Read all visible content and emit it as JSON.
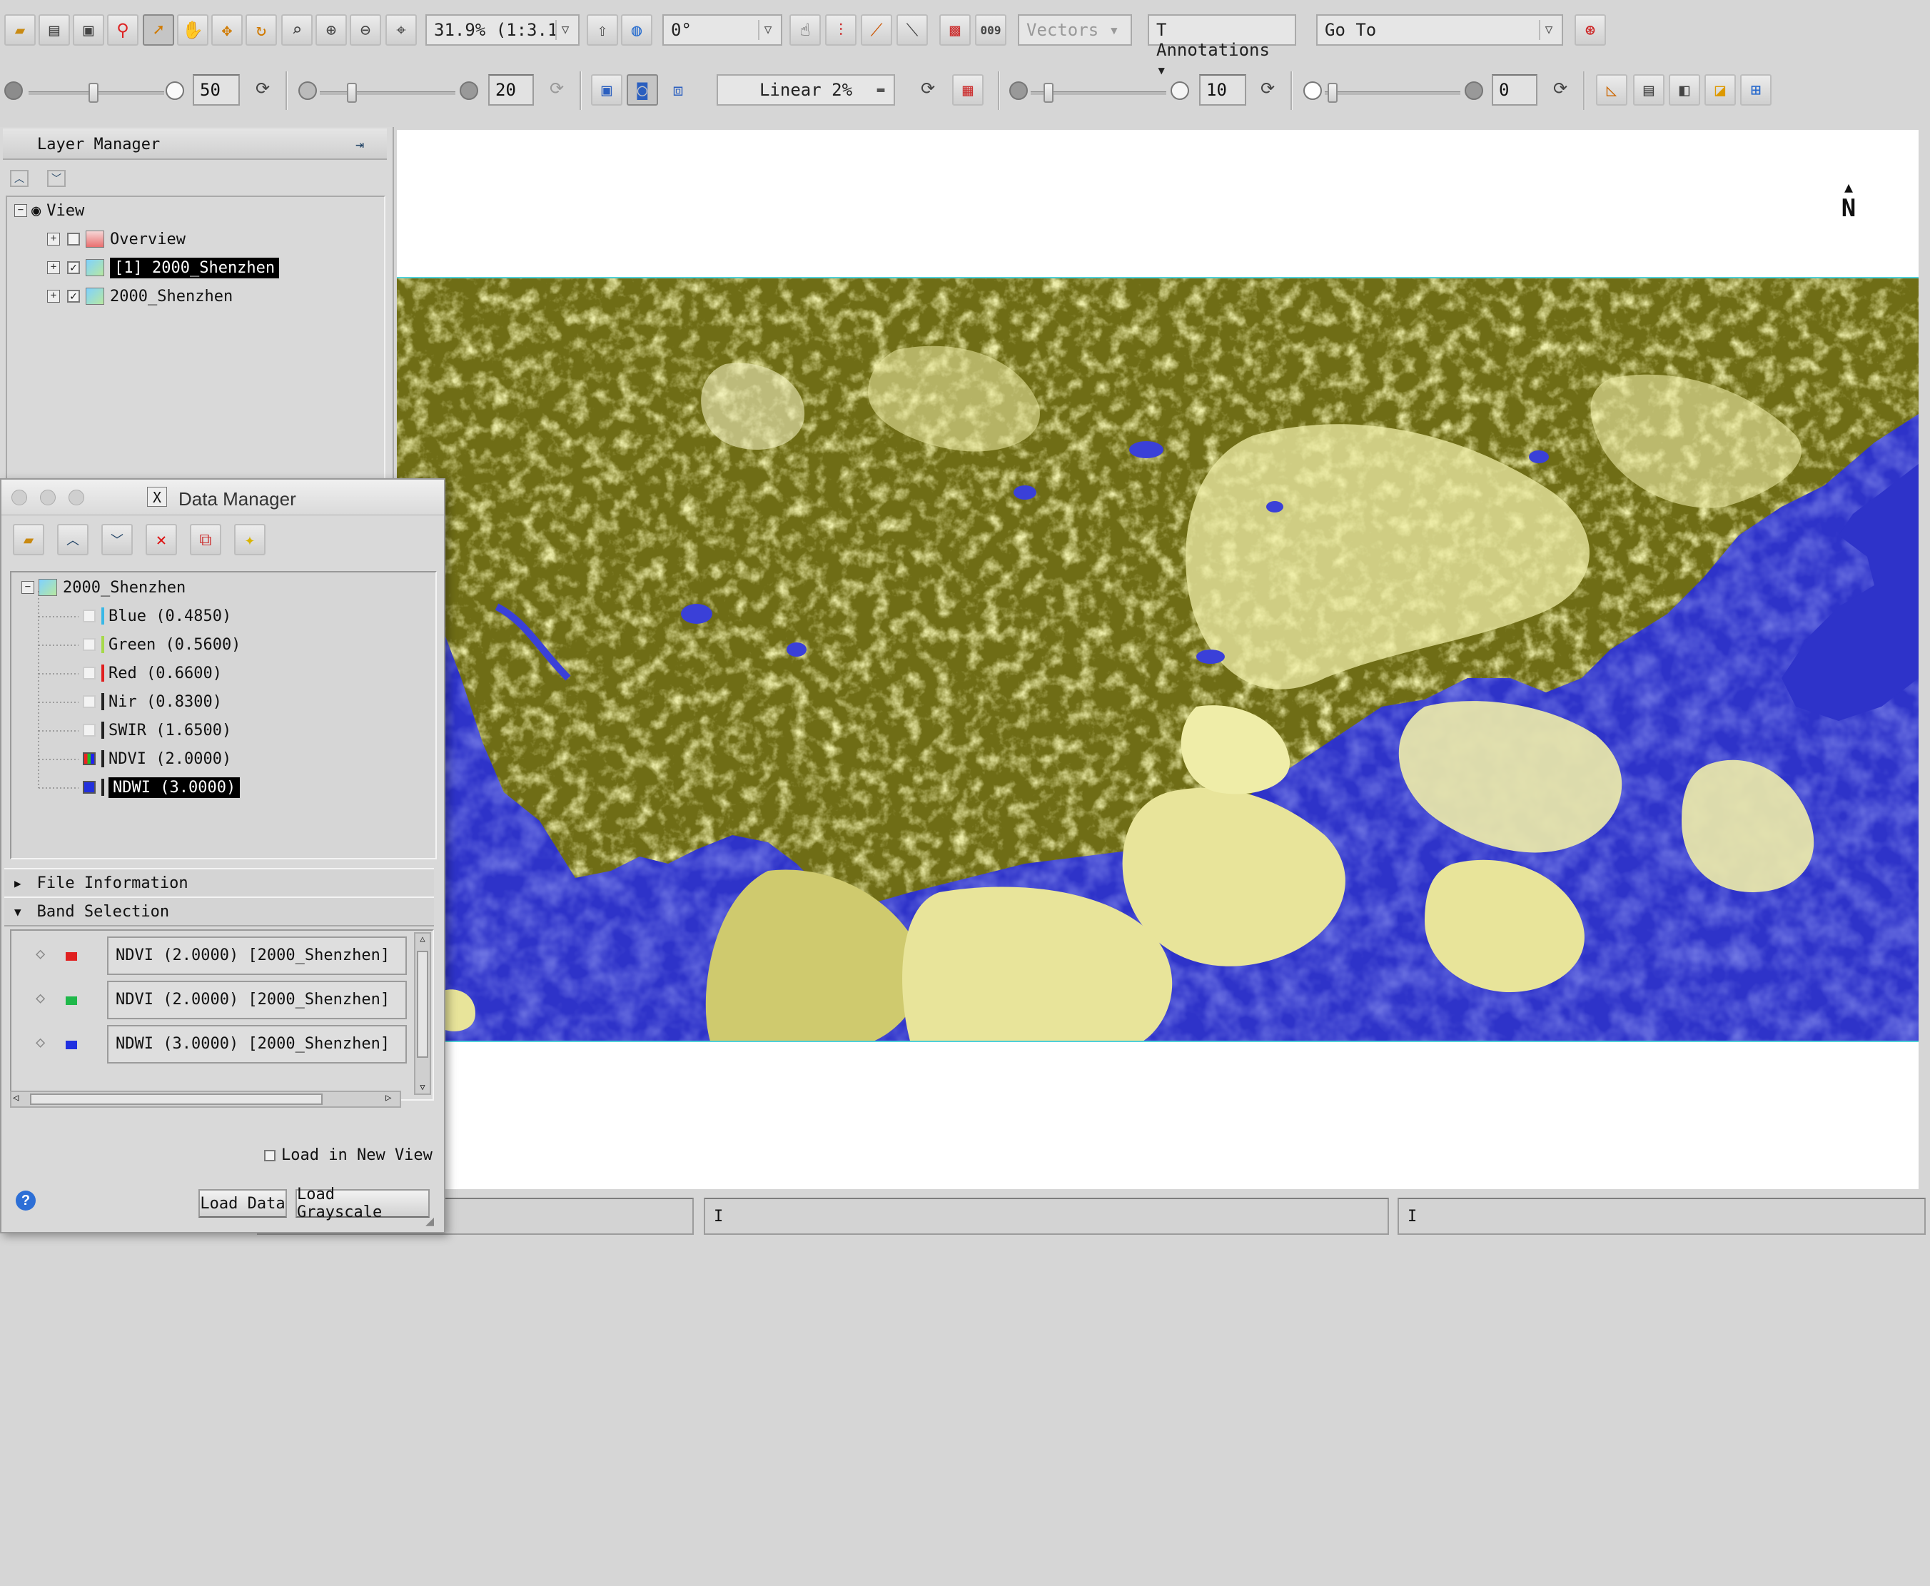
{
  "toolbar1": {
    "zoom": "31.9% (1:3.1",
    "rotation": "0°",
    "vectors_label": "Vectors",
    "annotations_label": "Annotations",
    "goto_placeholder": "Go To"
  },
  "toolbar2": {
    "brightness_value": "50",
    "contrast_value": "20",
    "stretch": "Linear 2%",
    "sharpen_value": "10",
    "transparency_value": "0"
  },
  "layer_manager": {
    "title": "Layer Manager",
    "root": "View",
    "items": [
      {
        "label": "Overview",
        "checked": false,
        "selected": false
      },
      {
        "label": "[1] 2000_Shenzhen",
        "checked": true,
        "selected": true
      },
      {
        "label": "2000_Shenzhen",
        "checked": true,
        "selected": false
      }
    ]
  },
  "data_manager": {
    "title": "Data Manager",
    "file": "2000_Shenzhen",
    "bands": [
      {
        "label": "Blue (0.4850)",
        "color": "#39b8e6",
        "selected": false
      },
      {
        "label": "Green (0.5600)",
        "color": "#a6d94a",
        "selected": false
      },
      {
        "label": "Red (0.6600)",
        "color": "#e02020",
        "selected": false
      },
      {
        "label": "Nir (0.8300)",
        "color": "#222222",
        "selected": false
      },
      {
        "label": "SWIR (1.6500)",
        "color": "#222222",
        "selected": false
      },
      {
        "label": "NDVI (2.0000)",
        "color": "#222222",
        "selected": false
      },
      {
        "label": "NDWI (3.0000)",
        "color": "#222222",
        "selected": true
      }
    ],
    "file_info_label": "File Information",
    "band_selection_label": "Band Selection",
    "band_selection": [
      {
        "channel_color": "#e02020",
        "value": "NDVI (2.0000) [2000_Shenzhen]"
      },
      {
        "channel_color": "#1fb84a",
        "value": "NDVI (2.0000) [2000_Shenzhen]"
      },
      {
        "channel_color": "#2030e0",
        "value": "NDWI (3.0000) [2000_Shenzhen]"
      }
    ],
    "load_new_view_label": "Load in New View",
    "load_data_label": "Load Data",
    "load_grayscale_label": "Load Grayscale"
  },
  "map": {
    "north_label": "N"
  }
}
